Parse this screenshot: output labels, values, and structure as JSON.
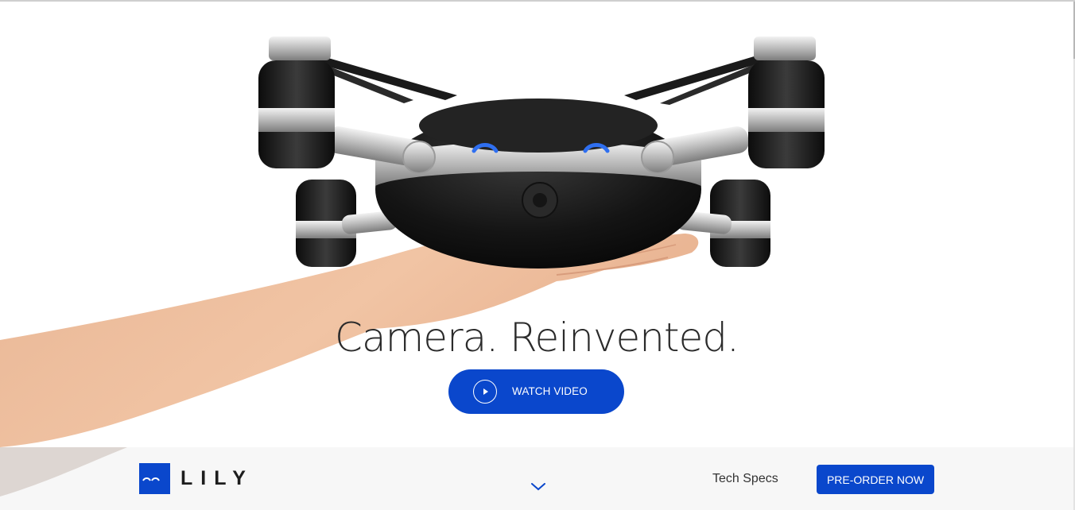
{
  "hero": {
    "headline": "Camera. Reinvented.",
    "watch_video_label": "WATCH VIDEO",
    "image_subject": "drone-held-in-hand"
  },
  "nav": {
    "logo_text": "LILY",
    "tech_specs_label": "Tech Specs",
    "preorder_label": "PRE-ORDER NOW",
    "scroll_icon": "chevron-down-icon"
  },
  "colors": {
    "brand_blue": "#0a47cc",
    "led_blue": "#2f6ff0",
    "headline_text": "#2b2b2b",
    "bar_background": "#f7f7f7"
  }
}
